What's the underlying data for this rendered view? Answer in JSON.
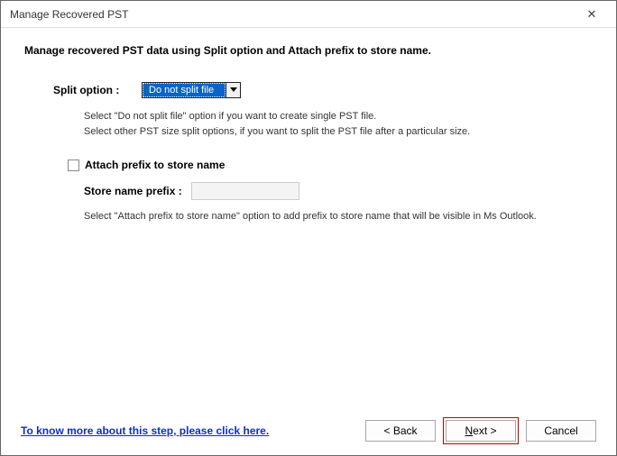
{
  "window": {
    "title": "Manage Recovered PST",
    "closeGlyph": "✕"
  },
  "heading": "Manage recovered PST data using Split option and Attach prefix to store name.",
  "split": {
    "label": "Split option :",
    "selected": "Do not split file",
    "hint1": "Select \"Do not split file\" option if you want to create single PST file.",
    "hint2": "Select other PST size split options, if you want to split the PST file after a particular size."
  },
  "prefix": {
    "checkboxLabel": "Attach prefix to store name",
    "checked": false,
    "inputLabel": "Store name prefix :",
    "inputValue": "",
    "hint": "Select \"Attach prefix to store name\" option to add prefix to store name that will be visible in Ms Outlook."
  },
  "helpLink": "To know more about this step, please click here.",
  "buttons": {
    "back": "< Back",
    "nextPrefix": "N",
    "nextSuffix": "ext >",
    "cancel": "Cancel"
  }
}
